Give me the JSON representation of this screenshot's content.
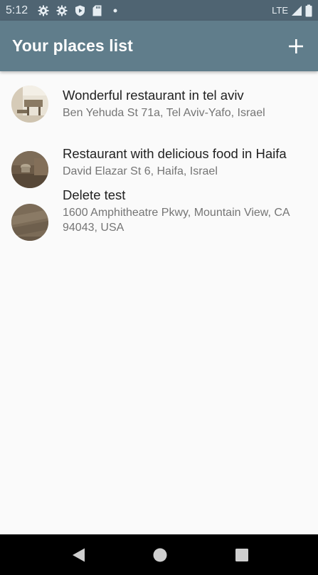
{
  "status_bar": {
    "time": "5:12",
    "network": "LTE",
    "icons": [
      "gear-icon",
      "gear-icon",
      "shield-play-icon",
      "sd-card-icon",
      "dot-icon",
      "signal-icon",
      "battery-icon"
    ]
  },
  "app_bar": {
    "title": "Your places list",
    "action_icon": "plus-icon"
  },
  "places": [
    {
      "title": "Wonderful restaurant in tel aviv",
      "address": "Ben Yehuda St 71a, Tel Aviv-Yafo, Israel"
    },
    {
      "title": "Restaurant with delicious food in Haifa",
      "address": "David Elazar St 6, Haifa, Israel"
    },
    {
      "title": "Delete test",
      "address": "1600 Amphitheatre Pkwy, Mountain View, CA 94043, USA"
    }
  ],
  "nav_bar": {
    "buttons": [
      "back-icon",
      "home-icon",
      "recents-icon"
    ]
  },
  "colors": {
    "status_bar": "#4f6472",
    "app_bar": "#607d8b",
    "background": "#fafafa",
    "title_text": "#222222",
    "subtitle_text": "#757575"
  }
}
